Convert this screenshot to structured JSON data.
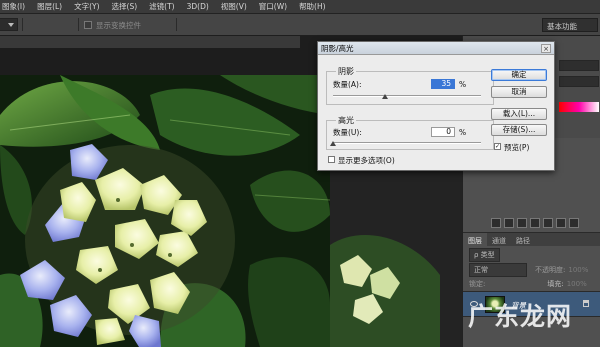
{
  "menu": {
    "items": [
      "图象(I)",
      "图层(L)",
      "文字(Y)",
      "选择(S)",
      "滤镜(T)",
      "3D(D)",
      "视图(V)",
      "窗口(W)",
      "帮助(H)"
    ]
  },
  "options_bar": {
    "show_transform_label": "显示变换控件",
    "workspace_label": "基本功能"
  },
  "dialog": {
    "title": "阴影/高光",
    "close_glyph": "×",
    "shadows": {
      "group_label": "阴影",
      "amount_label": "数量(A):",
      "amount_value": "35",
      "amount_fraction": 0.35,
      "unit": "%"
    },
    "highlights": {
      "group_label": "高光",
      "amount_label": "数量(U):",
      "amount_value": "0",
      "amount_fraction": 0,
      "unit": "%"
    },
    "more_options_label": "显示更多选项(O)",
    "buttons": {
      "ok": "确定",
      "cancel": "取消",
      "load": "载入(L)...",
      "save": "存储(S)...",
      "preview_label": "预览(P)",
      "preview_check": "✓"
    }
  },
  "layers_panel": {
    "tabs": [
      "图层",
      "通道",
      "路径"
    ],
    "filter_label": "ρ 类型",
    "blend_mode": "正常",
    "opacity_label": "不透明度:",
    "opacity_value": "100%",
    "lock_label": "锁定:",
    "fill_label": "填充:",
    "fill_value": "100%",
    "layer_name": "背景"
  },
  "watermark": "广东龙网"
}
